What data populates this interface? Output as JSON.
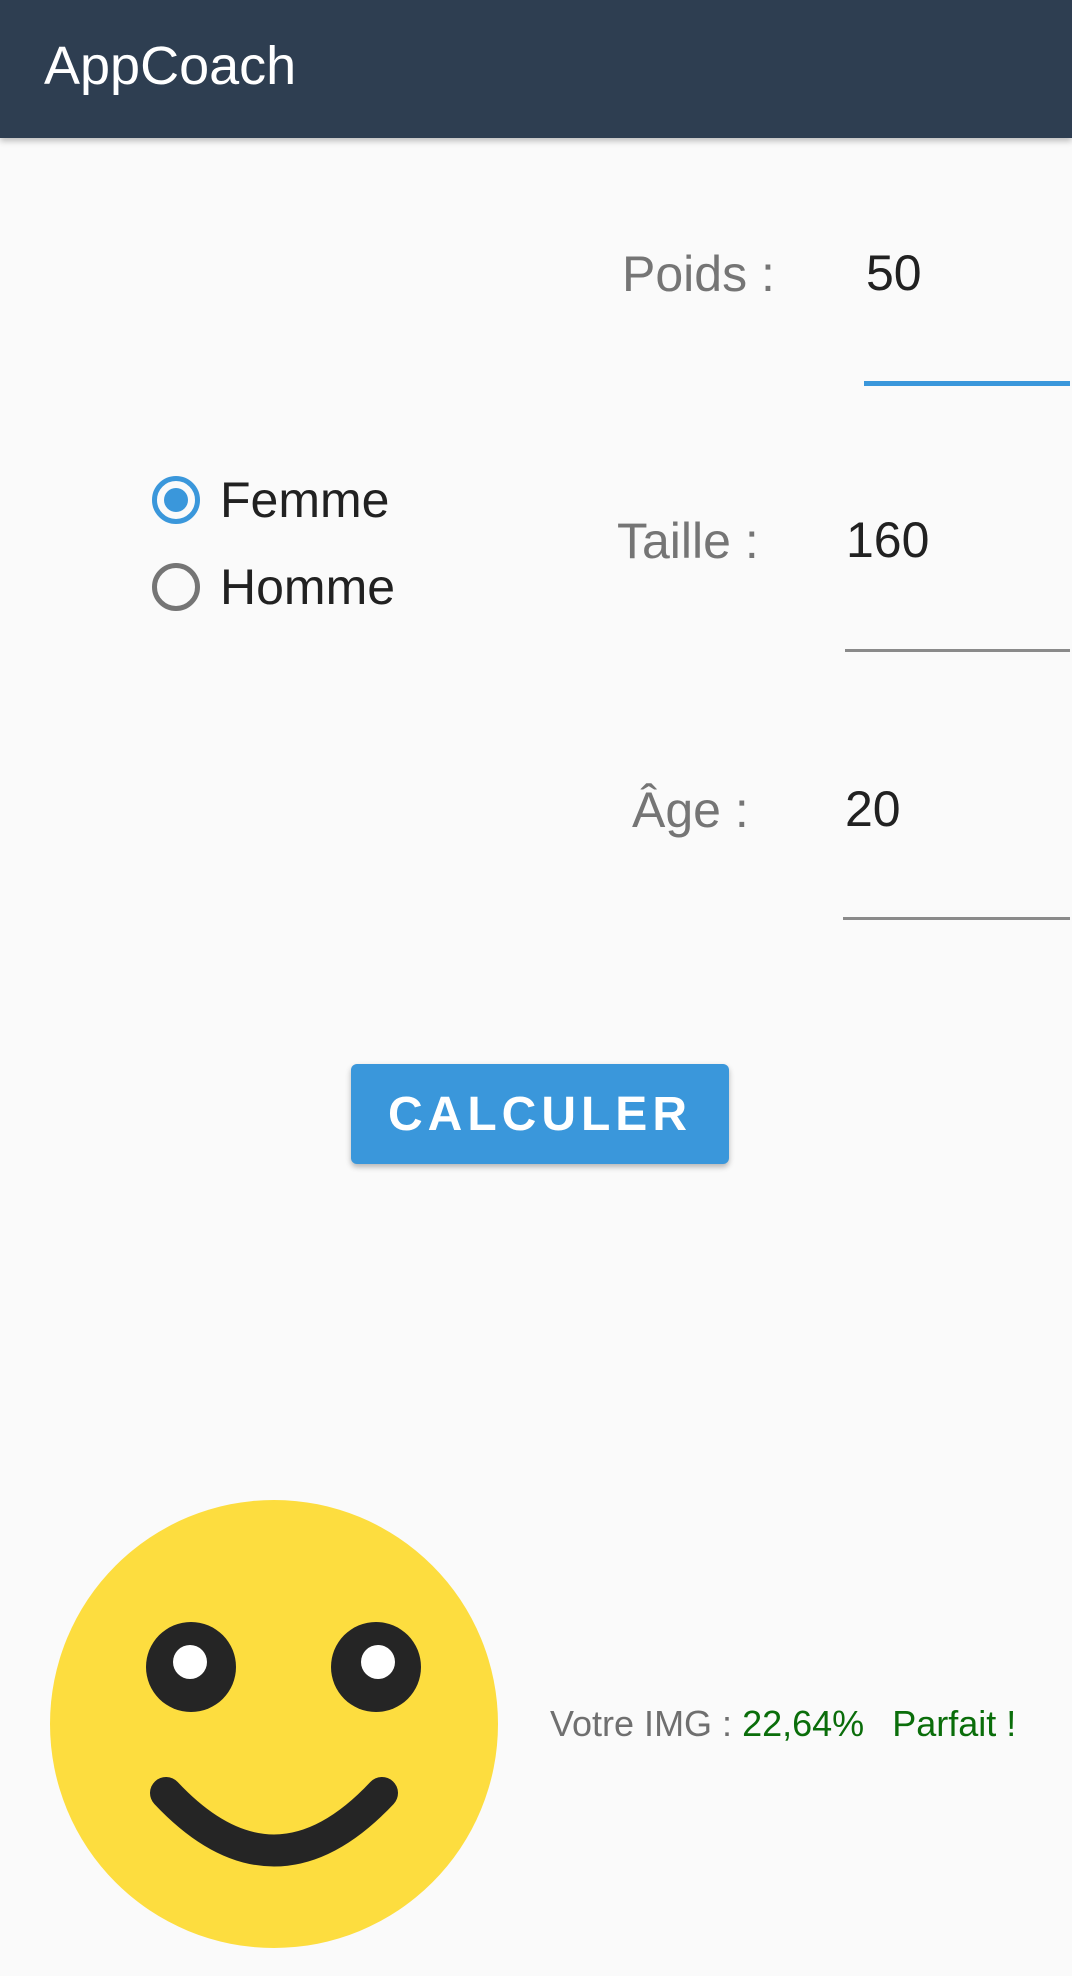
{
  "app": {
    "title": "AppCoach"
  },
  "form": {
    "weight": {
      "label": "Poids :",
      "value": "50"
    },
    "height": {
      "label": "Taille :",
      "value": "160"
    },
    "age": {
      "label": "Âge :",
      "value": "20"
    },
    "sex_options": [
      {
        "label": "Femme",
        "checked": true
      },
      {
        "label": "Homme",
        "checked": false
      }
    ],
    "calculate_label": "CALCULER"
  },
  "result": {
    "label": "Votre IMG :",
    "value": "22,64%",
    "message": "Parfait !",
    "icon": "smiley-face-icon"
  },
  "colors": {
    "app_bar": "#2e3e51",
    "accent": "#3a97db",
    "result_text": "#0a6d0a",
    "smiley_face": "#fddd3f"
  }
}
